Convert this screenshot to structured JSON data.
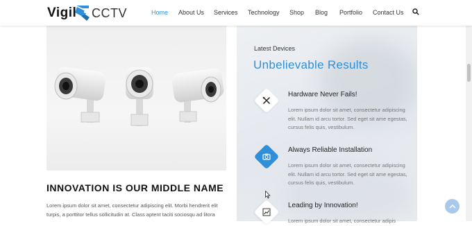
{
  "brand": {
    "name_bold": "Vigil",
    "name_light": "CCTV"
  },
  "nav": {
    "items": [
      {
        "label": "Home",
        "active": true
      },
      {
        "label": "About Us",
        "active": false
      },
      {
        "label": "Services",
        "active": false
      },
      {
        "label": "Technology",
        "active": false
      },
      {
        "label": "Shop",
        "active": false
      },
      {
        "label": "Blog",
        "active": false
      },
      {
        "label": "Portfolio",
        "active": false
      },
      {
        "label": "Contact Us",
        "active": false
      }
    ]
  },
  "left": {
    "headline": "INNOVATION IS OUR MIDDLE NAME",
    "body": "Lorem ipsum dolor sit amet, consectetur adipiscing elit. Morbi hendrerit elit turpis, a porttitor tellus sollicitudin at. Class aptent taciti sociosqu ad litora"
  },
  "right": {
    "eyebrow": "Latest Devices",
    "title": "Unbelievable Results",
    "features": [
      {
        "title": "Hardware Never Fails!",
        "text": "Lorem ipsum dolor sit amet, consectetur adipiscing elit. Nullam id arcu tortor. Sed eget sit ame egestas, cursus felis quis, vestibulum.",
        "icon": "tools-icon",
        "style": "white"
      },
      {
        "title": "Always Reliable Installation",
        "text": "Lorem ipsum dolor sit amet, consectetur adipiscing elit. Nullam id arcu tortor. Sed eget sit ame egestas, cursus felis quis, vestibulum.",
        "icon": "camera-icon",
        "style": "blue"
      },
      {
        "title": "Leading by Innovation!",
        "text": "Lorem ipsum dolor sit amet, consectetur adipis",
        "icon": "chart-icon",
        "style": "white"
      }
    ]
  },
  "colors": {
    "accent": "#2f8fd8",
    "heading": "#111111",
    "muted": "#777777"
  }
}
